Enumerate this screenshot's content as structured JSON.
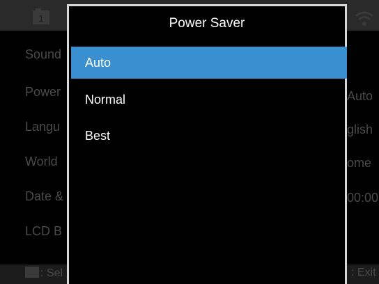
{
  "background_menu": {
    "rows": [
      {
        "label": "Sound",
        "value": ""
      },
      {
        "label": "Power",
        "value": "Auto"
      },
      {
        "label": "Langu",
        "value": "glish"
      },
      {
        "label": "World",
        "value": "ome"
      },
      {
        "label": "Date &",
        "value": "00:00"
      },
      {
        "label": "LCD B",
        "value": ""
      }
    ],
    "tab_number": "1",
    "footer": {
      "left": ": Sel",
      "right": ": Exit"
    }
  },
  "dialog": {
    "title": "Power Saver",
    "options": [
      {
        "label": "Auto",
        "selected": true
      },
      {
        "label": "Normal",
        "selected": false
      },
      {
        "label": "Best",
        "selected": false
      }
    ]
  },
  "colors": {
    "selection": "#3a8fd0",
    "dialog_border": "#d8d8d8",
    "dim_text": "#4a4a4a"
  }
}
